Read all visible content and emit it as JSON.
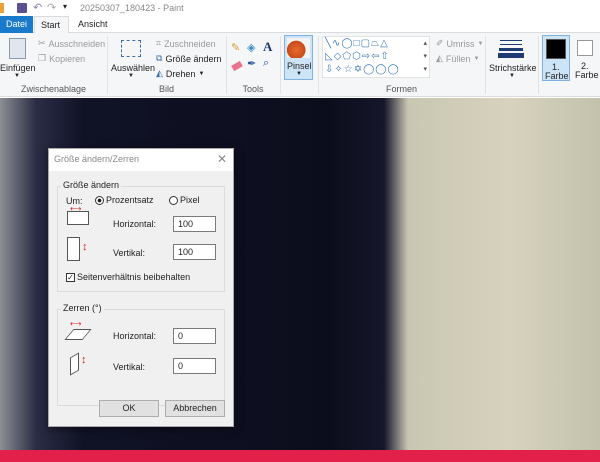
{
  "window": {
    "title": "20250307_180423 - Paint"
  },
  "tabs": [
    {
      "label": "Datei",
      "active_color": "#1979ca"
    },
    {
      "label": "Start"
    },
    {
      "label": "Ansicht"
    }
  ],
  "ribbon": {
    "clipboard": {
      "paste": "Einfügen",
      "cut": "Ausschneiden",
      "copy": "Kopieren",
      "label": "Zwischenablage"
    },
    "image": {
      "select": "Auswählen",
      "crop": "Zuschneiden",
      "resize": "Größe ändern",
      "rotate": "Drehen",
      "label": "Bild"
    },
    "tools": {
      "label": "Tools"
    },
    "brush": {
      "label": "Pinsel"
    },
    "shapes": {
      "outline": "Umriss",
      "fill": "Füllen",
      "label": "Formen"
    },
    "stroke": {
      "label": "Strichstärke"
    },
    "color1": {
      "label1": "1.",
      "label2": "Farbe",
      "value": "#000000"
    },
    "color2": {
      "label1": "2.",
      "label2": "Farbe",
      "value": "#ffffff"
    }
  },
  "dialog": {
    "title": "Größe ändern/Zerren",
    "resize": {
      "legend": "Größe ändern",
      "by": "Um:",
      "percent": "Prozentsatz",
      "pixel": "Pixel",
      "selected": "Prozentsatz",
      "h_label": "Horizontal:",
      "h_value": "100",
      "v_label": "Vertikal:",
      "v_value": "100",
      "keep_ratio": "Seitenverhältnis beibehalten",
      "keep_ratio_checked": true
    },
    "skew": {
      "legend": "Zerren (°)",
      "h_label": "Horizontal:",
      "h_value": "0",
      "v_label": "Vertikal:",
      "v_value": "0"
    },
    "ok": "OK",
    "cancel": "Abbrechen"
  }
}
